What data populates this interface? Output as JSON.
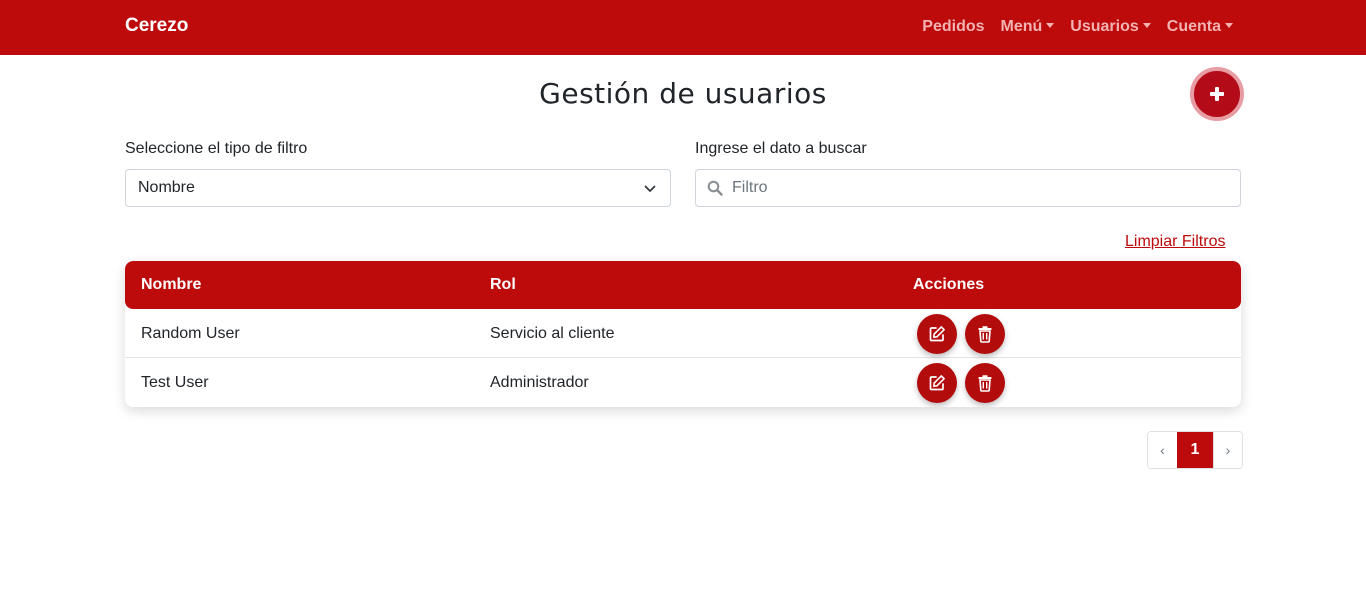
{
  "navbar": {
    "brand": "Cerezo",
    "items": [
      {
        "label": "Pedidos",
        "dropdown": false
      },
      {
        "label": "Menú",
        "dropdown": true
      },
      {
        "label": "Usuarios",
        "dropdown": true
      },
      {
        "label": "Cuenta",
        "dropdown": true
      }
    ]
  },
  "page": {
    "title": "Gestión de usuarios"
  },
  "add_button": {
    "icon": "plus-icon"
  },
  "filters": {
    "type_label": "Seleccione el tipo de filtro",
    "type_value": "Nombre",
    "search_label": "Ingrese el dato a buscar",
    "search_placeholder": "Filtro",
    "search_value": "",
    "clear_label": "Limpiar Filtros"
  },
  "table": {
    "headers": [
      "Nombre",
      "Rol",
      "Acciones"
    ],
    "rows": [
      {
        "name": "Random User",
        "role": "Servicio al cliente"
      },
      {
        "name": "Test User",
        "role": "Administrador"
      }
    ]
  },
  "pagination": {
    "prev": "‹",
    "current": "1",
    "next": "›"
  },
  "colors": {
    "primary": "#bd0a0a",
    "nav_text": "#f3b2b2"
  }
}
